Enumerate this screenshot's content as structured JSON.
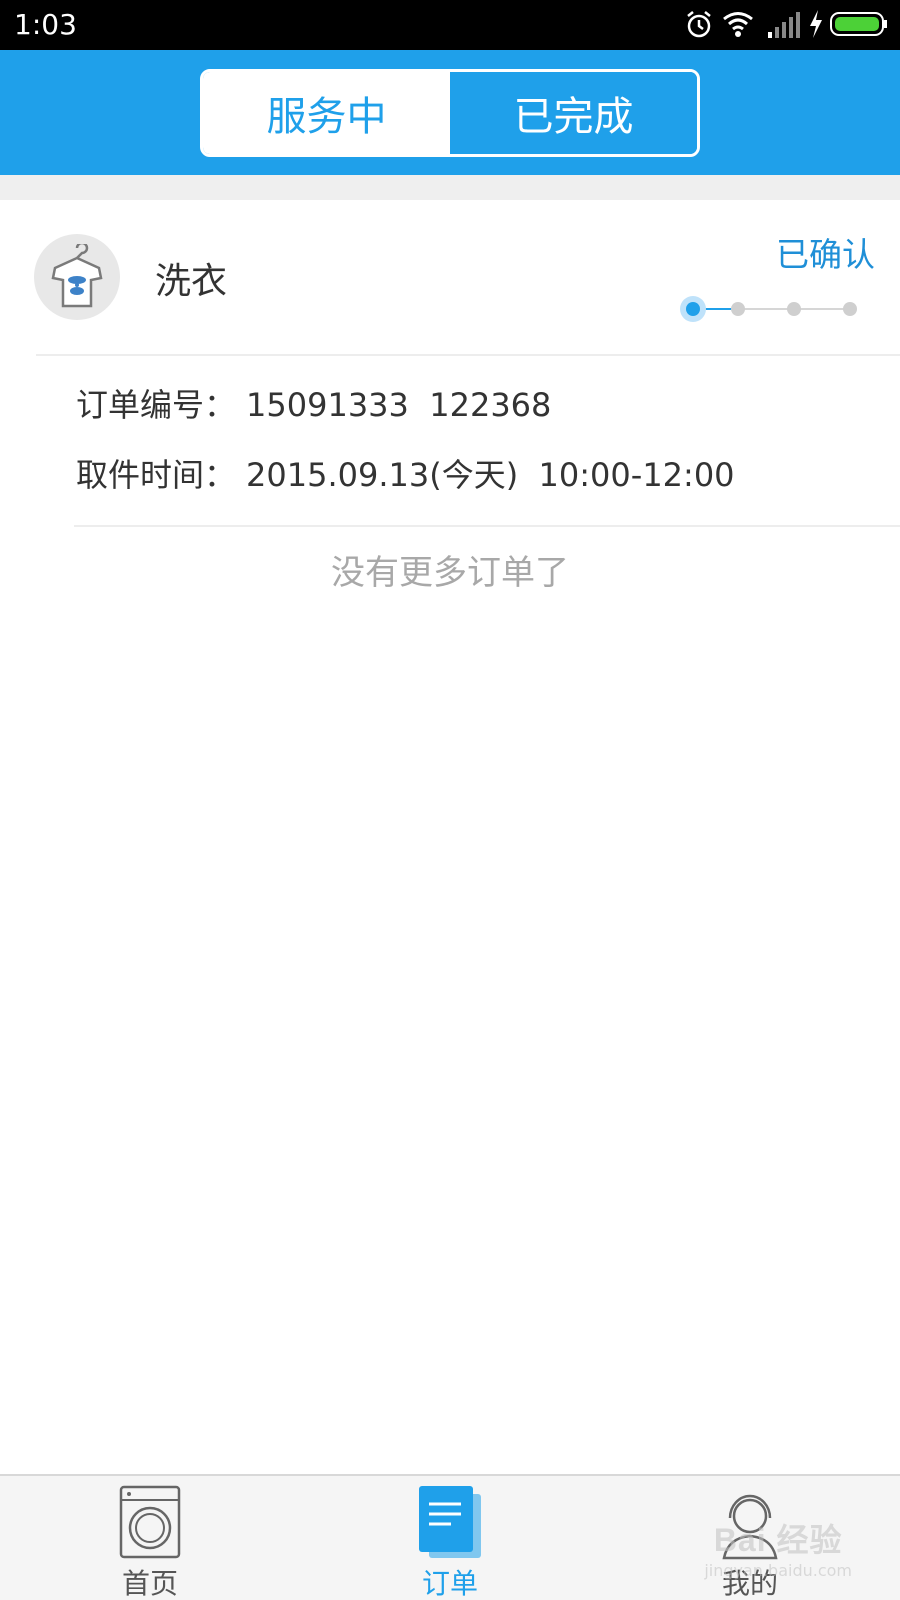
{
  "status_bar": {
    "time": "1:03",
    "icons": [
      "alarm-icon",
      "wifi-icon",
      "signal-icon",
      "charging-icon",
      "battery-icon"
    ]
  },
  "header": {
    "tabs": [
      {
        "label": "服务中",
        "active": true
      },
      {
        "label": "已完成",
        "active": false
      }
    ]
  },
  "order": {
    "service_name": "洗衣",
    "status": "已确认",
    "progress_steps": 4,
    "progress_current": 1,
    "order_no_label": "订单编号：",
    "order_no": "15091333  122368",
    "pickup_label": "取件时间：",
    "pickup_time": "2015.09.13(今天)  10:00-12:00",
    "icon": "tshirt-hanger-icon"
  },
  "no_more_text": "没有更多订单了",
  "bottom_nav": {
    "items": [
      {
        "label": "首页",
        "icon": "washing-machine-icon",
        "active": false
      },
      {
        "label": "订单",
        "icon": "order-list-icon",
        "active": true
      },
      {
        "label": "我的",
        "icon": "profile-icon",
        "active": false
      }
    ]
  },
  "watermark": {
    "brand": "Bai 经验",
    "url": "jingyan.baidu.com"
  },
  "colors": {
    "accent": "#1fa0ea",
    "status_text": "#1f8fd7",
    "muted_text": "#a8a8a8"
  }
}
